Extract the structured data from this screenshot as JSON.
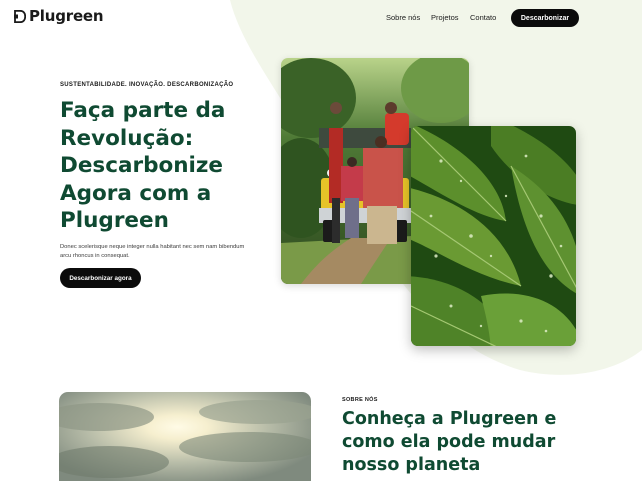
{
  "brand": {
    "name": "Plugreen",
    "logo_icon": "plug-d-logo-icon"
  },
  "nav": {
    "sobre": "Sobre nós",
    "projetos": "Projetos",
    "contato": "Contato",
    "cta": "Descarbonizar"
  },
  "hero": {
    "eyebrow": "SUSTENTABILIDADE. INOVAÇÃO. DESCARBONIZAÇÃO",
    "headline": "Faça parte da Revolução: Descarbonize Agora com a Plugreen",
    "body": "Donec scelerisque neque integer nulla habitant nec sem nam bibendum arcu rhoncus in consequat.",
    "cta": "Descarbonizar agora"
  },
  "images": {
    "people": "photo-people-loading-jeep",
    "leaves": "photo-wet-hosta-leaves",
    "sky": "photo-cloudy-sky"
  },
  "about": {
    "label": "SOBRE NÓS",
    "title": "Conheça a Plugreen e como ela pode mudar nosso planeta"
  },
  "colors": {
    "accent": "#0f4a32",
    "button": "#0b0b0b",
    "blob": "#f2f6ea"
  }
}
